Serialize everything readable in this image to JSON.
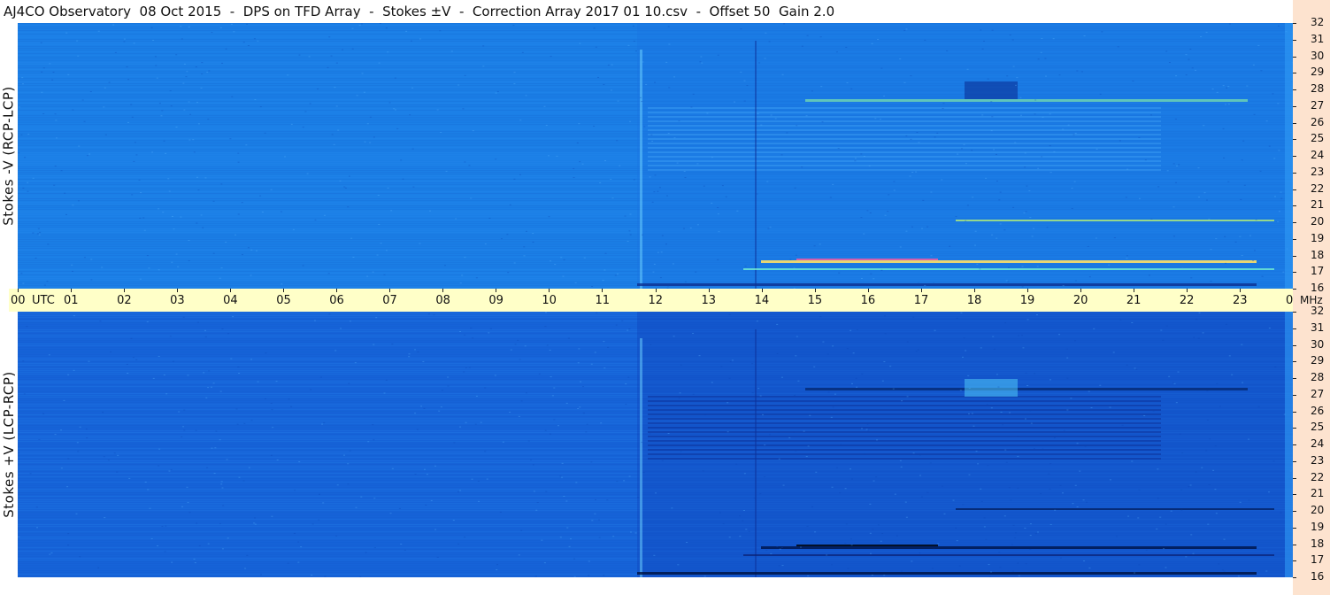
{
  "title": "AJ4CO Observatory  08 Oct 2015  -  DPS on TFD Array  -  Stokes ±V  -  Correction Array 2017 01 10.csv  -  Offset 50  Gain 2.0",
  "panels": [
    {
      "id": "top",
      "ylabel": "Stokes -V (RCP-LCP)",
      "base_color": "#1b7fe6"
    },
    {
      "id": "bottom",
      "ylabel": "Stokes +V (LCP-RCP)",
      "base_color": "#1663d8"
    }
  ],
  "freq_axis": {
    "ticks": [
      "32",
      "31",
      "30",
      "29",
      "28",
      "27",
      "26",
      "25",
      "24",
      "23",
      "22",
      "21",
      "20",
      "19",
      "18",
      "17",
      "16"
    ],
    "unit": "MHz"
  },
  "time_axis": {
    "ticks": [
      "00",
      "01",
      "02",
      "03",
      "04",
      "05",
      "06",
      "07",
      "08",
      "09",
      "10",
      "11",
      "12",
      "13",
      "14",
      "15",
      "16",
      "17",
      "18",
      "19",
      "20",
      "21",
      "22",
      "23",
      "00"
    ],
    "unit": "UTC"
  },
  "colors": {
    "axis_band": "#ffffc8",
    "right_column": "#fde3cf"
  }
}
